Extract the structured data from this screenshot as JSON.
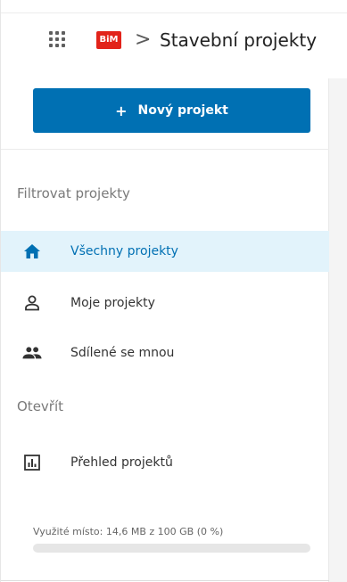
{
  "header": {
    "logo_text": "BiM",
    "breadcrumb_separator": ">",
    "title": "Stavební projekty"
  },
  "sidebar": {
    "new_project_button": {
      "icon": "+",
      "label": "Nový projekt"
    },
    "filter_heading": "Filtrovat projekty",
    "filter_items": [
      {
        "label": "Všechny projekty",
        "icon": "home-icon",
        "active": true
      },
      {
        "label": "Moje projekty",
        "icon": "person-icon",
        "active": false
      },
      {
        "label": "Sdílené se mnou",
        "icon": "people-icon",
        "active": false
      }
    ],
    "open_heading": "Otevřít",
    "open_items": [
      {
        "label": "Přehled projektů",
        "icon": "bar-chart-icon",
        "active": false
      }
    ],
    "storage": {
      "text": "Využité místo: 14,6 MB z 100 GB (0 %)",
      "used_percent": 0
    }
  },
  "colors": {
    "accent": "#0070b3",
    "active_bg": "#e2f3fb",
    "logo_red": "#e2231a"
  }
}
